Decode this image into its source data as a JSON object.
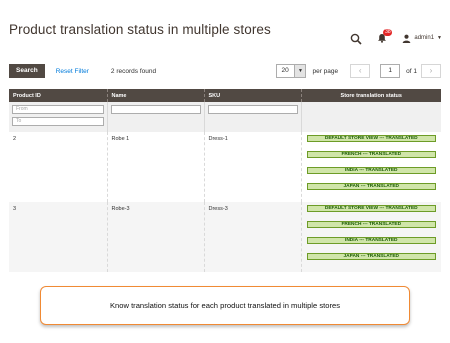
{
  "page": {
    "title": "Product translation status in multiple stores"
  },
  "header": {
    "notification_count": "38",
    "user_name": "admin1"
  },
  "toolbar": {
    "search_label": "Search",
    "reset_label": "Reset Filter",
    "records": "2 records found",
    "per_page_value": "20",
    "per_page_label": "per page",
    "current_page": "1",
    "total_pages_label": "of 1"
  },
  "grid": {
    "columns": [
      "Product ID",
      "Name",
      "SKU",
      "Store translation status"
    ],
    "filters": {
      "from_placeholder": "From",
      "to_placeholder": "To"
    },
    "rows": [
      {
        "id": "2",
        "name": "Robe 1",
        "sku": "Dress-1",
        "statuses": [
          "DEFAULT STORE VIEW --- TRANSLATED",
          "FRENCH --- TRANSLATED",
          "INDIA --- TRANSLATED",
          "JAPAN --- TRANSLATED"
        ]
      },
      {
        "id": "3",
        "name": "Robe-3",
        "sku": "Dress-3",
        "statuses": [
          "DEFAULT STORE VIEW --- TRANSLATED",
          "FRENCH --- TRANSLATED",
          "INDIA --- TRANSLATED",
          "JAPAN --- TRANSLATED"
        ]
      }
    ]
  },
  "callout": {
    "text": "Know translation status for each product translated in multiple stores"
  },
  "colors": {
    "header_bg": "#514943",
    "link": "#007bdb",
    "status_bg": "#d0e5a9",
    "status_text": "#185b00",
    "callout_border": "#f08a34"
  }
}
